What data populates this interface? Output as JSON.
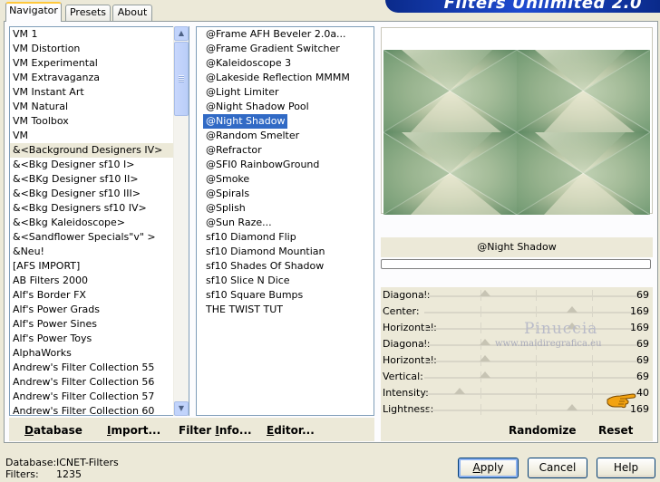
{
  "window": {
    "banner_title": "Filters Unlimited 2.0"
  },
  "tabs": [
    {
      "label": "Navigator",
      "active": true
    },
    {
      "label": "Presets",
      "active": false
    },
    {
      "label": "About",
      "active": false
    }
  ],
  "categories": {
    "selected": "&<Background Designers IV>",
    "items": [
      "VM 1",
      "VM Distortion",
      "VM Experimental",
      "VM Extravaganza",
      "VM Instant Art",
      "VM Natural",
      "VM Toolbox",
      "VM",
      "&<Background Designers IV>",
      "&<Bkg Designer sf10 I>",
      "&<BKg Designer sf10 II>",
      "&<Bkg Designer sf10 III>",
      "&<Bkg Designers sf10 IV>",
      "&<Bkg Kaleidoscope>",
      "&<Sandflower Specials\"v\" >",
      "&Neu!",
      "[AFS IMPORT]",
      "AB Filters 2000",
      "Alf's Border FX",
      "Alf's Power Grads",
      "Alf's Power Sines",
      "Alf's Power Toys",
      "AlphaWorks",
      "Andrew's Filter Collection 55",
      "Andrew's Filter Collection 56",
      "Andrew's Filter Collection 57",
      "Andrew's Filter Collection 60"
    ]
  },
  "filters": {
    "selected": "@Night Shadow",
    "items": [
      "@Frame AFH Beveler 2.0a...",
      "@Frame Gradient Switcher",
      "@Kaleidoscope 3",
      "@Lakeside Reflection MMMM",
      "@Light Limiter",
      "@Night Shadow Pool",
      "@Night Shadow",
      "@Random Smelter",
      "@Refractor",
      "@SFI0 RainbowGround",
      "@Smoke",
      "@Spirals",
      "@Splish",
      "@Sun Raze...",
      "sf10 Diamond Flip",
      "sf10 Diamond Mountian",
      "sf10 Shades Of Shadow",
      "sf10 Slice N Dice",
      "sf10 Square Bumps",
      "THE TWIST TUT"
    ]
  },
  "actions": {
    "database_key": "D",
    "database_rest": "atabase",
    "import_key": "I",
    "import_rest": "mport...",
    "filter_info_pre": "Filter ",
    "filter_info_key": "I",
    "filter_info_rest": "nfo...",
    "editor_key": "E",
    "editor_rest": "ditor..."
  },
  "preview": {
    "filter_name": "@Night Shadow",
    "progress": 0
  },
  "sliders": [
    {
      "label": "Diagonal:",
      "value": "69",
      "max": 255
    },
    {
      "label": "Center:",
      "value": "169",
      "max": 255
    },
    {
      "label": "Horizontal:",
      "value": "169",
      "max": 255
    },
    {
      "label": "Diagonal:",
      "value": "69",
      "max": 255
    },
    {
      "label": "Horizontal:",
      "value": "69",
      "max": 255
    },
    {
      "label": "Vertical:",
      "value": "69",
      "max": 255
    },
    {
      "label": "Intensity:",
      "value": "40",
      "max": 255
    },
    {
      "label": "Lightness:",
      "value": "169",
      "max": 255
    }
  ],
  "watermark": {
    "name": "Pinuccia",
    "site": "www.maidiregrafica.eu"
  },
  "preview_actions": {
    "randomize": "Randomize",
    "reset": "Reset"
  },
  "status": {
    "database_label": "Database:",
    "database_value": "ICNET-Filters",
    "filters_label": "Filters:",
    "filters_value": "1235"
  },
  "dialog": {
    "apply_key": "A",
    "apply_rest": "pply",
    "cancel": "Cancel",
    "help": "Help"
  },
  "colors": {
    "selection": "#316ac5",
    "dialog_bg": "#ece9d8",
    "banner": "#1f4bd0"
  }
}
